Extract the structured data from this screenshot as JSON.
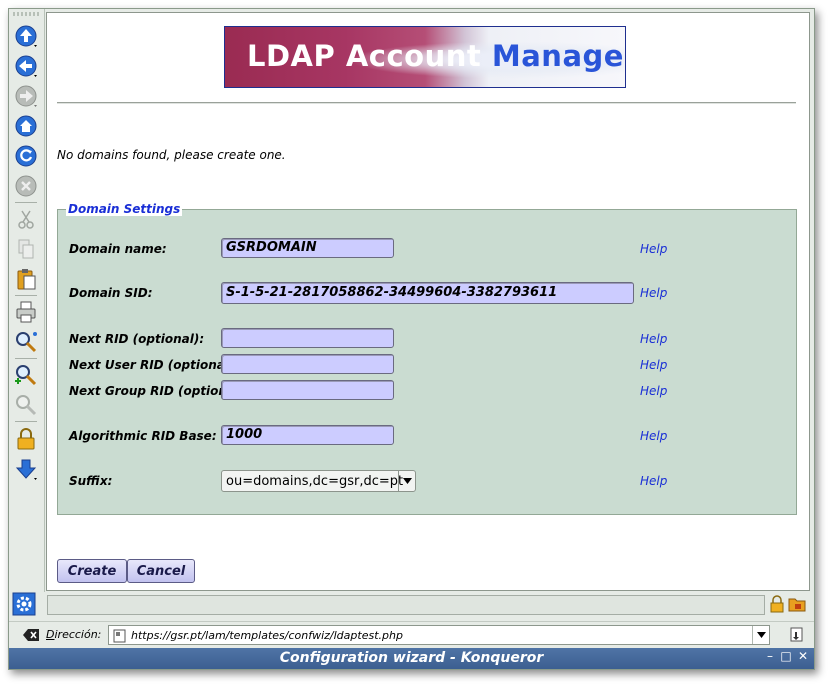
{
  "app": {
    "window_title": "Configuration wizard - Konqueror"
  },
  "toolbar": {
    "icons": [
      "up-icon",
      "back-icon",
      "forward-icon",
      "home-icon",
      "reload-icon",
      "stop-icon",
      "cut-icon",
      "copy-icon",
      "paste-icon",
      "print-icon",
      "find-icon",
      "zoom-in-icon",
      "zoom-out-icon",
      "lock-icon",
      "download-icon"
    ]
  },
  "banner": {
    "word1": "LDAP",
    "word2": "Account",
    "word3": "Manager"
  },
  "notice": "No domains found, please create one.",
  "domain_settings": {
    "legend": "Domain Settings",
    "fields": [
      {
        "label": "Domain name:",
        "value": "GSRDOMAIN",
        "help": "Help"
      },
      {
        "label": "Domain SID:",
        "value": "S-1-5-21-2817058862-34499604-3382793611",
        "help": "Help"
      },
      {
        "label": "Next RID (optional):",
        "value": "",
        "help": "Help"
      },
      {
        "label": "Next User RID (optional):",
        "value": "",
        "help": "Help"
      },
      {
        "label": "Next Group RID (optional):",
        "value": "",
        "help": "Help"
      },
      {
        "label": "Algorithmic RID Base:",
        "value": "1000",
        "help": "Help"
      },
      {
        "label": "Suffix:",
        "value": "ou=domains,dc=gsr,dc=pt",
        "help": "Help"
      }
    ]
  },
  "buttons": {
    "create": "Create",
    "cancel": "Cancel"
  },
  "location": {
    "label_prefix": "D",
    "label_rest": "irección:",
    "url": "https://gsr.pt/lam/templates/confwiz/ldaptest.php"
  },
  "colors": {
    "fieldset_bg": "#cadcd1",
    "input_bg": "#ccccff",
    "help_link": "#1a2fd6",
    "titlebar": "#4f74a6"
  }
}
